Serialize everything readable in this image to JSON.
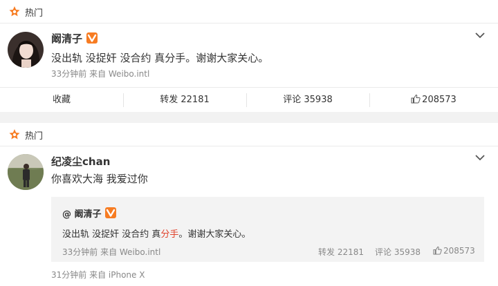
{
  "post1": {
    "hot_label": "热门",
    "username": "阚清子",
    "text": "没出轨 没捉奸 没合约 真分手。谢谢大家关心。",
    "meta": "33分钟前 来自 Weibo.intl",
    "actions": {
      "favorite": "收藏",
      "repost": "转发 22181",
      "comment": "评论 35938",
      "like": "208573"
    }
  },
  "post2": {
    "hot_label": "热门",
    "username": "纪凌尘chan",
    "text": "你喜欢大海 我爱过你",
    "quote": {
      "user": "@ 阚清子",
      "text_before": "没出轨 没捉奸 没合约 真",
      "text_highlight": "分手",
      "text_after": "。谢谢大家关心。",
      "meta": "33分钟前 来自 Weibo.intl",
      "repost": "转发 22181",
      "comment": "评论  35938",
      "like": "208573"
    },
    "meta": "31分钟前 来自 iPhone X"
  },
  "colors": {
    "hot_icon": "#f77c22",
    "vip_badge": "#f77c22",
    "highlight": "#e0432c"
  },
  "icons": [
    "hot-icon",
    "vip-badge-icon",
    "chevron-down-icon",
    "thumb-up-icon"
  ]
}
